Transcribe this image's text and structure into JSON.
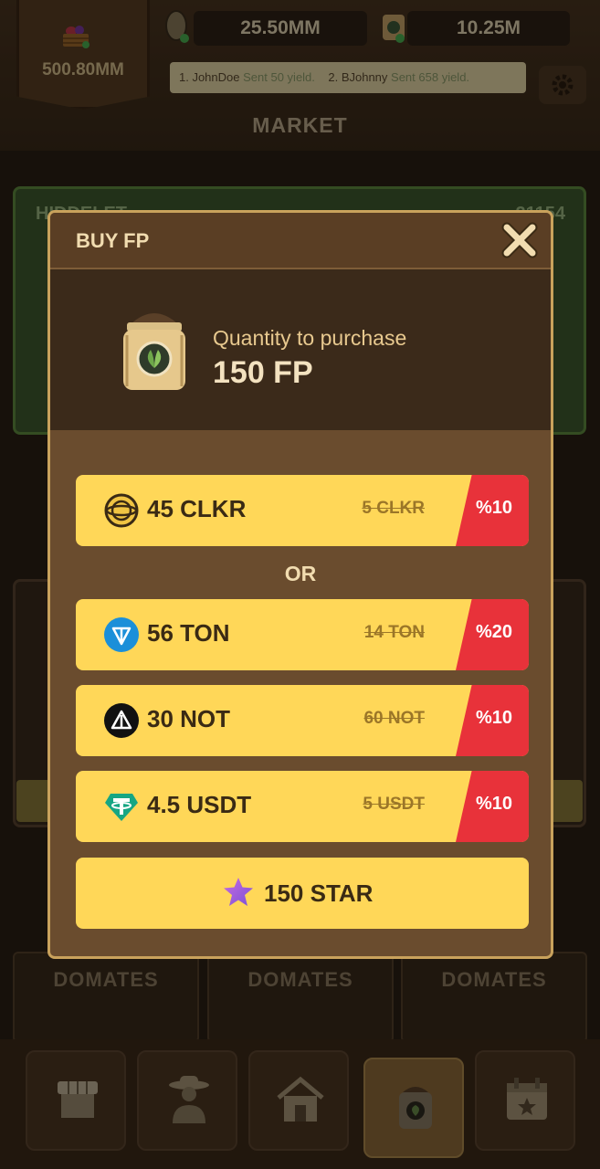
{
  "header": {
    "basket_value": "500.80MM",
    "seeds_value": "25.50MM",
    "sack_value": "10.25M"
  },
  "ticker": {
    "entries": [
      {
        "prefix": "1. JohnDoe",
        "sent": "Sent 50 yield."
      },
      {
        "prefix": "2. BJohnny",
        "sent": "Sent 658 yield."
      }
    ]
  },
  "page_title": "MARKET",
  "bg_card": {
    "title": "HIDDELET",
    "right": "21154"
  },
  "shelves": [
    "DOMATES",
    "DOMATES",
    "DOMATES"
  ],
  "modal": {
    "title": "BUY FP",
    "quantity_label": "Quantity to purchase",
    "quantity_value": "150 FP",
    "or_label": "OR",
    "options": [
      {
        "icon": "clkr-coin-icon",
        "price": "45 CLKR",
        "old_price": "5 CLKR",
        "discount": "%10"
      },
      {
        "icon": "ton-coin-icon",
        "price": "56 TON",
        "old_price": "14 TON",
        "discount": "%20"
      },
      {
        "icon": "not-coin-icon",
        "price": "30 NOT",
        "old_price": "60 NOT",
        "discount": "%10"
      },
      {
        "icon": "usdt-coin-icon",
        "price": "4.5 USDT",
        "old_price": "5 USDT",
        "discount": "%10"
      }
    ],
    "star_option": {
      "icon": "star-icon",
      "price": "150 STAR"
    }
  },
  "colors": {
    "button_yellow": "#ffd758",
    "discount_red": "#e8323a",
    "modal_border": "#c9a25c",
    "ton_blue": "#1b8fd9",
    "usdt_teal": "#17a683"
  }
}
